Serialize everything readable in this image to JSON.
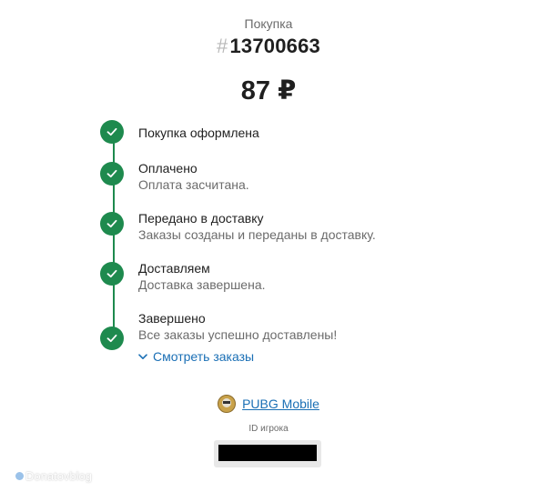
{
  "header": {
    "purchase_label": "Покупка",
    "hash_symbol": "#",
    "order_number": "13700663",
    "amount": "87 ₽"
  },
  "timeline": {
    "steps": [
      {
        "title": "Покупка оформлена",
        "description": ""
      },
      {
        "title": "Оплачено",
        "description": "Оплата засчитана."
      },
      {
        "title": "Передано в доставку",
        "description": "Заказы созданы и переданы в доставку."
      },
      {
        "title": "Доставляем",
        "description": "Доставка завершена."
      },
      {
        "title": "Завершено",
        "description": "Все заказы успешно доставлены!"
      }
    ],
    "view_orders_label": "Смотреть заказы",
    "status_color": "#1e8a4e"
  },
  "game": {
    "name": "PUBG Mobile",
    "icon": "pubg-icon",
    "player_id_label": "ID игрока"
  },
  "watermark": {
    "text": "Donatovblog"
  },
  "colors": {
    "accent_link": "#1a6fb5",
    "success": "#1e8a4e"
  }
}
